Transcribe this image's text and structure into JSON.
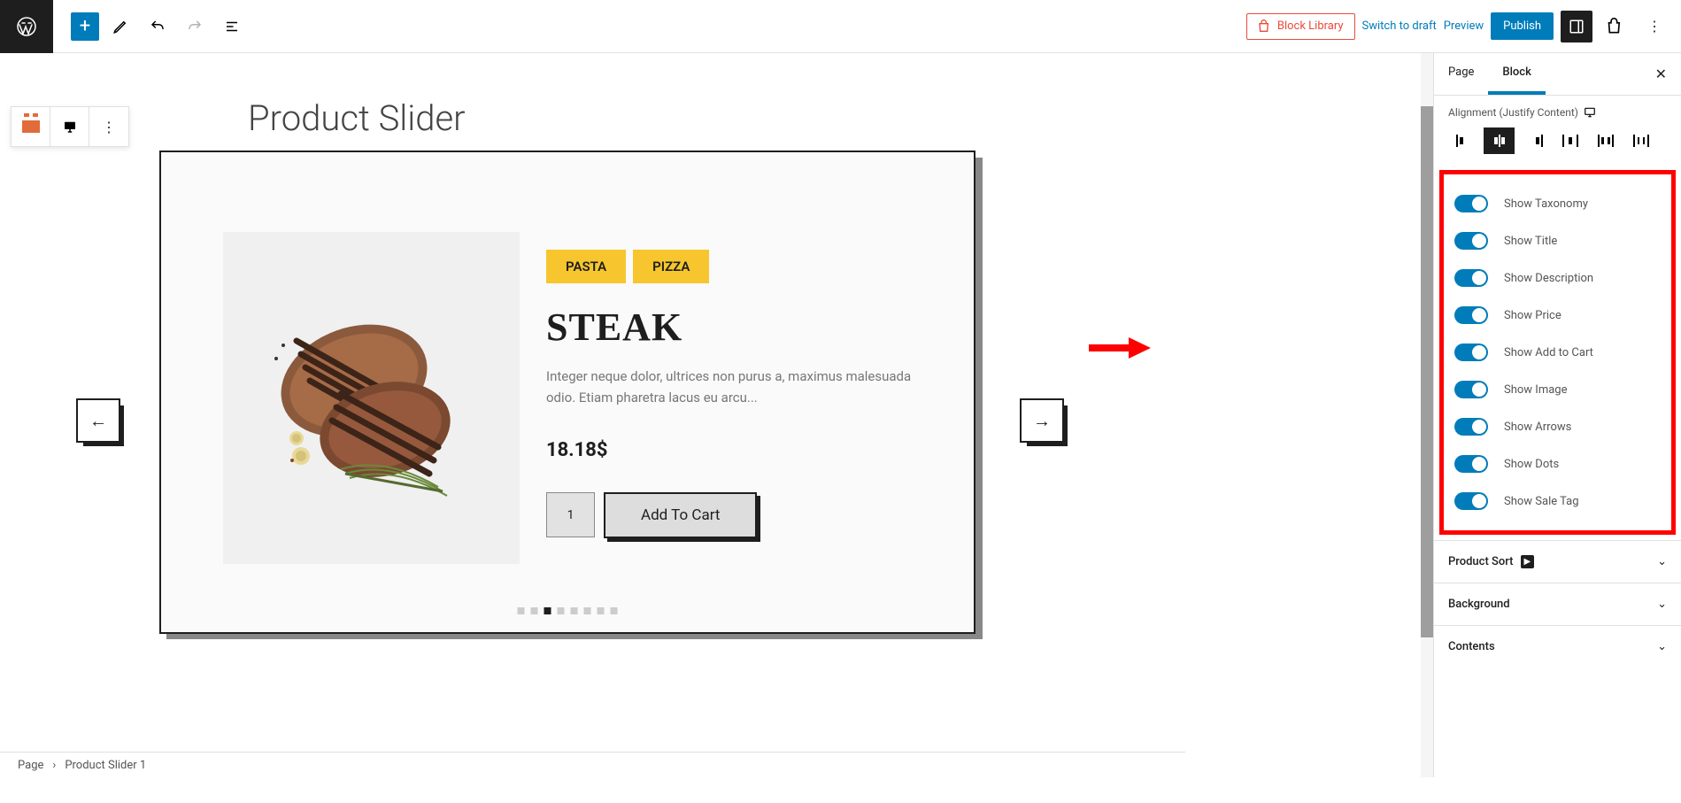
{
  "topbar": {
    "block_library": "Block Library",
    "switch_draft": "Switch to draft",
    "preview": "Preview",
    "publish": "Publish"
  },
  "page": {
    "title": "Product Slider"
  },
  "product": {
    "tags": [
      "PASTA",
      "PIZZA"
    ],
    "title": "STEAK",
    "desc": "Integer neque dolor, ultrices non purus a, maximus malesuada odio. Etiam pharetra lacus eu arcu...",
    "price": "18.18$",
    "qty": "1",
    "add_to_cart": "Add To Cart",
    "image_alt": "Grilled steak with rosemary and garlic",
    "dots_count": 8,
    "dots_active": 3
  },
  "sidebar": {
    "tab_page": "Page",
    "tab_block": "Block",
    "alignment_label": "Alignment (Justify Content)",
    "toggles": [
      {
        "label": "Show Taxonomy",
        "on": true
      },
      {
        "label": "Show Title",
        "on": true
      },
      {
        "label": "Show Description",
        "on": true
      },
      {
        "label": "Show Price",
        "on": true
      },
      {
        "label": "Show Add to Cart",
        "on": true
      },
      {
        "label": "Show Image",
        "on": true
      },
      {
        "label": "Show Arrows",
        "on": true
      },
      {
        "label": "Show Dots",
        "on": true
      },
      {
        "label": "Show Sale Tag",
        "on": true
      }
    ],
    "accordion": [
      {
        "label": "Product Sort",
        "tag": true
      },
      {
        "label": "Background",
        "tag": false
      },
      {
        "label": "Contents",
        "tag": false
      }
    ]
  },
  "footer": {
    "page": "Page",
    "current": "Product Slider 1"
  }
}
